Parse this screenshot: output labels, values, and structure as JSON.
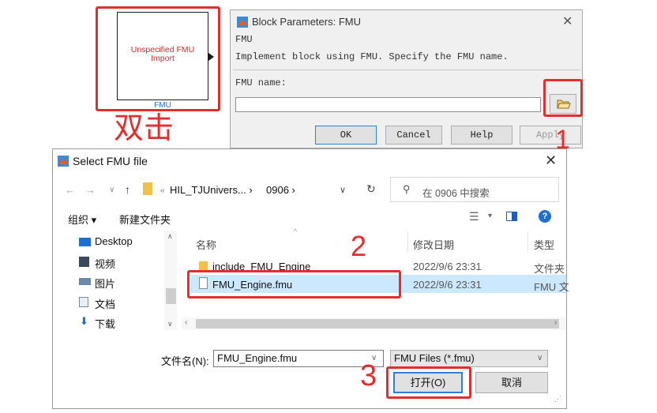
{
  "simulink_block": {
    "label_line1": "Unspecified FMU",
    "label_line2": "Import",
    "name": "FMU"
  },
  "annotations": {
    "double_click": "双击",
    "step1": "1",
    "step2": "2",
    "step3": "3"
  },
  "block_params_dialog": {
    "title": "Block Parameters: FMU",
    "group_label": "FMU",
    "description": "Implement block using FMU. Specify the FMU name.",
    "name_label": "FMU name:",
    "name_value": "",
    "buttons": {
      "ok": "OK",
      "cancel": "Cancel",
      "help": "Help",
      "apply": "Apply"
    }
  },
  "select_file_dialog": {
    "title": "Select FMU file",
    "address": {
      "part1": "HIL_TJUnivers...",
      "part2": "0906"
    },
    "search_placeholder": "在 0906 中搜索",
    "toolbar": {
      "organize": "组织 ▾",
      "new_folder": "新建文件夹"
    },
    "tree": [
      {
        "label": "Desktop",
        "icon": "desktop-icon"
      },
      {
        "label": "视频",
        "icon": "video-icon"
      },
      {
        "label": "图片",
        "icon": "pictures-icon"
      },
      {
        "label": "文档",
        "icon": "documents-icon"
      },
      {
        "label": "下载",
        "icon": "download-icon"
      }
    ],
    "columns": {
      "name": "名称",
      "date": "修改日期",
      "type": "类型"
    },
    "files": [
      {
        "name": "include_FMU_Engine",
        "date": "2022/9/6 23:31",
        "type": "文件夹",
        "icon": "folder-icon"
      },
      {
        "name": "FMU_Engine.fmu",
        "date": "2022/9/6 23:31",
        "type": "FMU 文",
        "icon": "file-icon",
        "selected": true
      }
    ],
    "file_name_label": "文件名(N):",
    "file_name_value": "FMU_Engine.fmu",
    "file_type_value": "FMU Files (*.fmu)",
    "open_button": "打开(O)",
    "cancel_button": "取消"
  },
  "colors": {
    "annotation_red": "#e42d2d",
    "block_text_red": "#e8232a",
    "selection_blue": "#cce8ff",
    "accent_blue": "#2f7ed8"
  }
}
